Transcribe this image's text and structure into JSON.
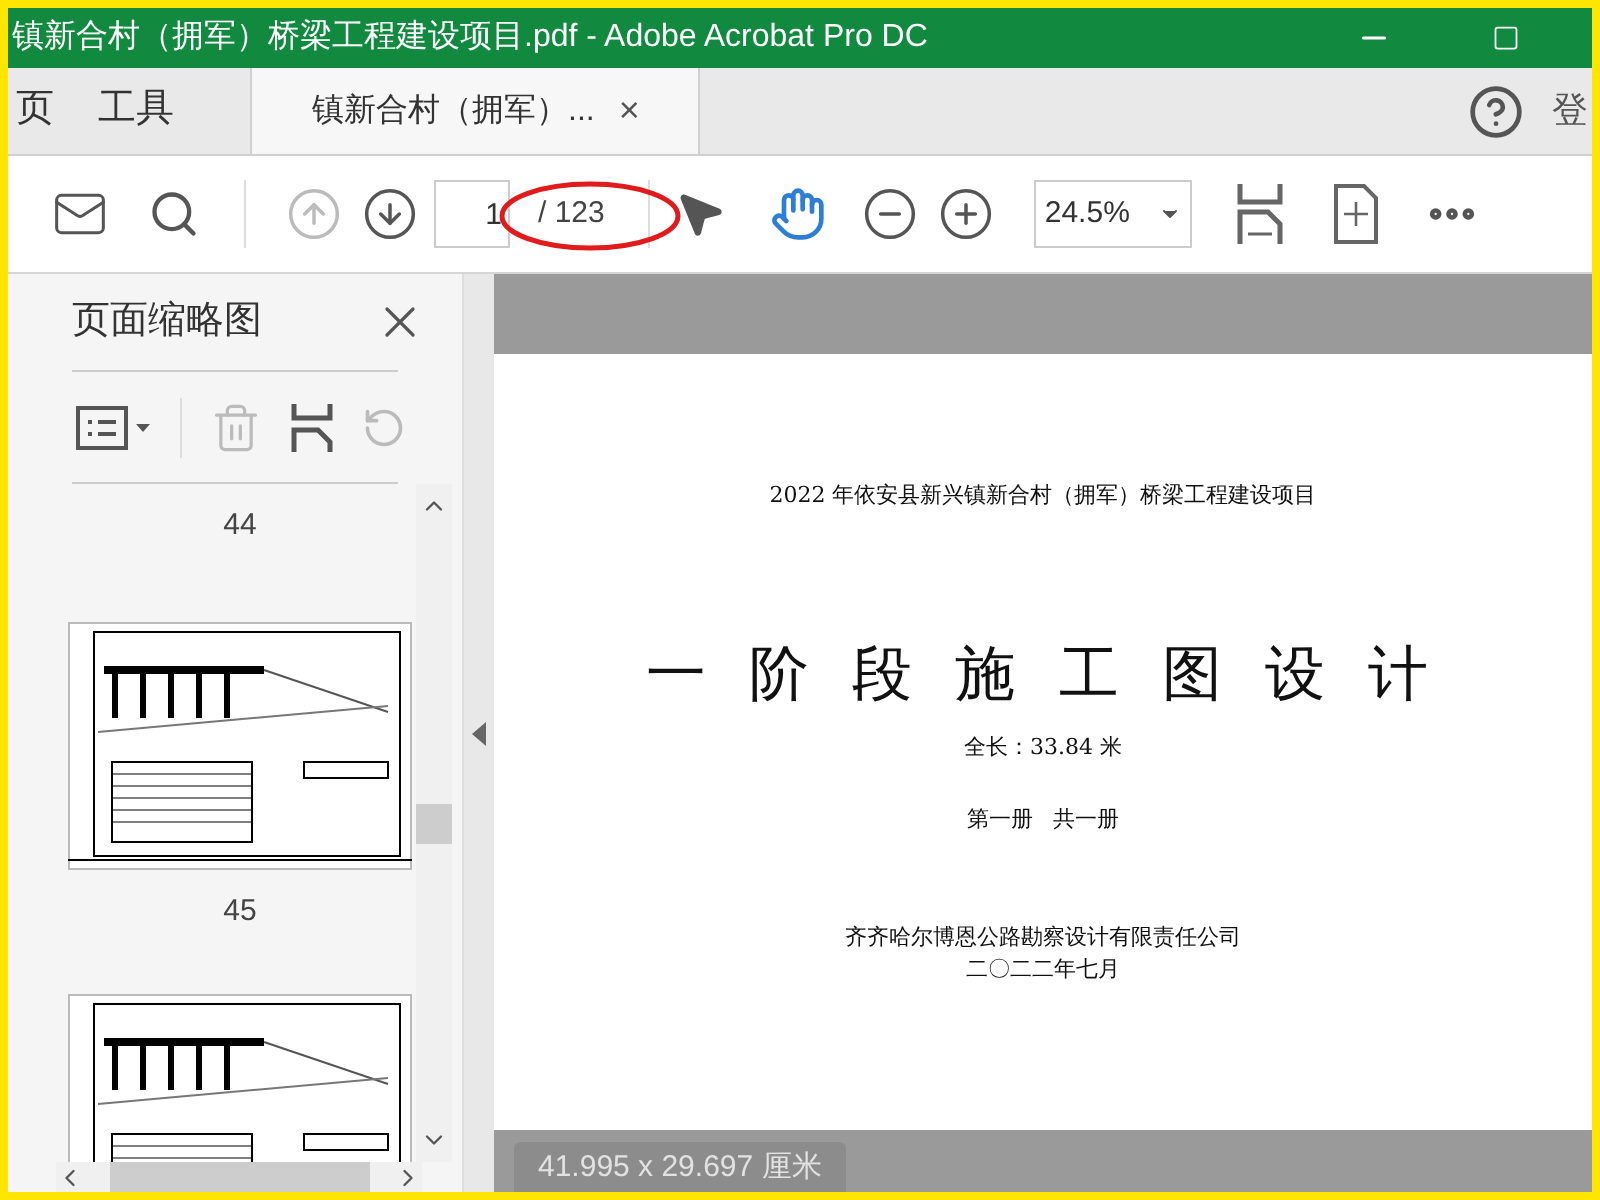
{
  "window": {
    "title": "镇新合村（拥军）桥梁工程建设项目.pdf - Adobe Acrobat Pro DC"
  },
  "nav_tabs": [
    {
      "label": "页",
      "selected": false
    },
    {
      "label": "工具",
      "selected": false
    },
    {
      "label": "镇新合村（拥军）...",
      "selected": true
    }
  ],
  "tab_close": "×",
  "sign_in": "登",
  "toolbar": {
    "prev_disabled": true,
    "page_number": "1",
    "page_total": "/ 123",
    "zoom": "24.5%"
  },
  "sidebar": {
    "title": "页面缩略图",
    "thumbnails": [
      {
        "label": "44"
      },
      {
        "label": "45"
      }
    ]
  },
  "document_page": {
    "project": "2022 年依安县新兴镇新合村（拥军）桥梁工程建设项目",
    "title": "一 阶 段 施 工 图 设 计",
    "length": "全长：33.84 米",
    "volume": "第一册   共一册",
    "company": "齐齐哈尔博恩公路勘察设计有限责任公司",
    "date": "二〇二二年七月"
  },
  "page_size": "41.995 x 29.697 厘米"
}
